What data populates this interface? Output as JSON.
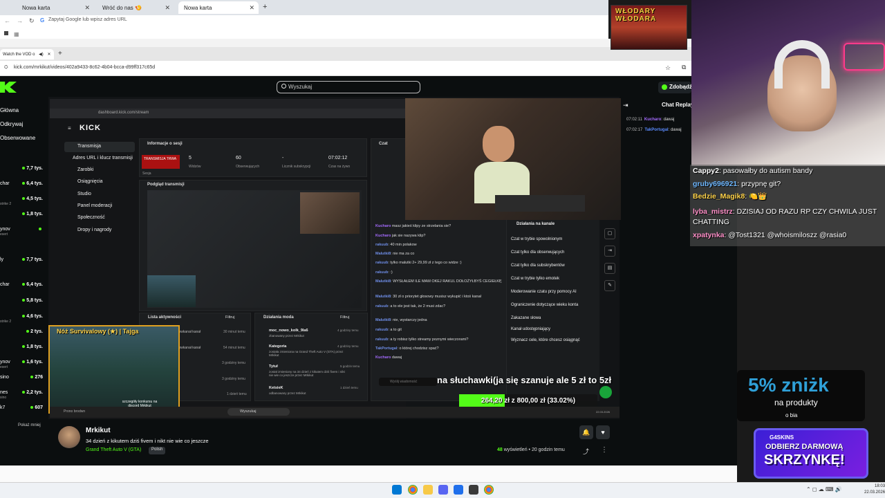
{
  "outer_browser": {
    "tabs": [
      "Nowa karta",
      "Wróć do nas 🍤",
      "Nowa karta"
    ],
    "address_placeholder": "Zapytaj Google lub wpisz adres URL"
  },
  "inner_browser": {
    "tab": "Watch the VOD o",
    "url": "kick.com/mrkikut/videos/402a9433-8c62-4b04-bcca-d99ff317c65d"
  },
  "kick": {
    "search_placeholder": "Wyszukaj",
    "zdobadz": "Zdobądź",
    "chat_replay_title": "Chat Replay",
    "side_nav": [
      "Główna",
      "Odkrywaj",
      "Obserwowane"
    ],
    "channels": [
      {
        "name": "",
        "sub": "",
        "viewers": "7,7 tys."
      },
      {
        "name": "char",
        "sub": "",
        "viewers": "6,4 tys."
      },
      {
        "name": "",
        "sub": "strike 2",
        "viewers": "4,5 tys."
      },
      {
        "name": "",
        "sub": "",
        "viewers": "1,8 tys."
      },
      {
        "name": "ynov",
        "sub": "esert",
        "viewers": ""
      },
      {
        "name": "ly",
        "sub": "",
        "viewers": "7,7 tys."
      },
      {
        "name": "char",
        "sub": "",
        "viewers": "6,4 tys."
      },
      {
        "name": "",
        "sub": "",
        "viewers": "5,8 tys."
      },
      {
        "name": "",
        "sub": "strike 2",
        "viewers": "4,6 tys."
      },
      {
        "name": "",
        "sub": "",
        "viewers": "2 tys."
      },
      {
        "name": "",
        "sub": "",
        "viewers": "1,8 tys."
      },
      {
        "name": "ynov",
        "sub": "esert",
        "viewers": "1,6 tys."
      },
      {
        "name": "sino",
        "sub": "",
        "viewers": "276"
      },
      {
        "name": "nes",
        "sub": "sino",
        "viewers": "2,2 tys."
      },
      {
        "name": "k7",
        "sub": "",
        "viewers": "607"
      }
    ],
    "show_less": "Pokaż mniej",
    "replay_chat": [
      {
        "time": "07:02:11",
        "user": "Kucharo",
        "msg": "dawaj"
      },
      {
        "time": "07:02:17",
        "user": "TakPortugal",
        "msg": "dawaj"
      }
    ]
  },
  "video": {
    "inner_logo": "KICK",
    "inner_url": "dashboard.kick.com/stream",
    "menu": [
      "Transmisja",
      "Adres URL i klucz transmisji",
      "Zarobki",
      "Osiągnięcia",
      "Studio",
      "Panel moderacji",
      "Społeczność",
      "Dropy i nagrody"
    ],
    "session_title": "Informacje o sesji",
    "live_badge": "TRANSMISJA TRWA",
    "stats": [
      {
        "value": "5",
        "label": "Widzów"
      },
      {
        "value": "60",
        "label": "Obserwujących"
      },
      {
        "value": "-",
        "label": "Licznik subskrypcji"
      },
      {
        "value": "07:02:12",
        "label": "Czas na żywo"
      }
    ],
    "session_sub": "Sesja",
    "preview_title": "Podgląd transmisji",
    "chat_title": "Czat",
    "activity_title": "Lista aktywności",
    "filter": "Filtruj",
    "mod_actions_title": "Działania moda",
    "channel_actions_title": "Działania na kanale",
    "channel_actions": [
      "Czat w trybie spowolnionym",
      "Czat tylko dla obserwujących",
      "Czat tylko dla subskrybentów",
      "Czat w trybie tylko emotek",
      "Moderowanie czatu przy pomocy AI",
      "Ograniczenie dotyczące wieku konta",
      "Zakazane słowa",
      "Kanał udostępniający",
      "Wyznacz cele, które chcesz osiągnąć"
    ],
    "inner_chat": [
      {
        "user": "Kucharo",
        "msg": "masz jakieś klipy ze strzelania sie?"
      },
      {
        "user": "Kucharo",
        "msg": "jak sie nazywa klip?"
      },
      {
        "user": "rakuub",
        "msg": "40 min polakow"
      },
      {
        "user": "Malutki8",
        "msg": "nie ma za co"
      },
      {
        "user": "rakuub",
        "msg": "tylko malutki 2+ 29,99 zł z tego co widze :)"
      },
      {
        "user": "rakuub",
        "msg": ":)"
      },
      {
        "user": "Malutki8",
        "msg": "WYSŁAŁEM ILE MAM OKEJ RAKUL DOŁOŻYŁBYŚ CEGIEŁKĘ"
      },
      {
        "user": "Malutki8",
        "msg": "30 zł o priorytet głosowy musisz wykupić i ktoś kanał"
      },
      {
        "user": "rakuub",
        "msg": "a to ele jest tak, że 2 musi zdac?"
      },
      {
        "user": "Malutki8",
        "msg": "nie, wystarczy jedna"
      },
      {
        "user": "rakuub",
        "msg": "a to git"
      },
      {
        "user": "rakuub",
        "msg": "a ty robisz tylko streamy poznymi wieczorami?"
      },
      {
        "user": "TakPortugal",
        "msg": "o której chodzisz spać?"
      },
      {
        "user": "Kucharo",
        "msg": "dawaj"
      }
    ],
    "chat_input_placeholder": "Wyślij wiadomość",
    "activity": [
      {
        "msg": "zowkanał kanał",
        "time": "30 minut temu"
      },
      {
        "msg": "zowkanał kanał",
        "time": "54 minut temu"
      },
      {
        "msg": "",
        "time": "3 godziny temu"
      },
      {
        "msg": "",
        "time": "3 godziny temu"
      },
      {
        "msg": "",
        "time": "1 dzień temu"
      }
    ],
    "mod_actions": [
      {
        "title": "moc_nowo_kolk_9la6",
        "desc": "zbanowany przez Mrkikut",
        "time": "4 godziny temu"
      },
      {
        "title": "Kategoria",
        "desc": "została zmieniona na Grand Theft Auto V (GTA) przez Mrkikut",
        "time": "4 godziny temu"
      },
      {
        "title": "Tytuł",
        "desc": "został zmieniony na 34 dzień z kikutem dziś fivem i nikt nie wie co jeszcze przez Mrkikut",
        "time": "5 godzin temu"
      },
      {
        "title": "KetsieK",
        "desc": "odbanowany przez Mrkikut",
        "time": "1 dzień temu"
      }
    ],
    "caption": "na słuchawki(ja się szanuje ale 5 zł to 5zł",
    "goal_text": "264,20 zł z 800,00 zł (33.02%)",
    "goal_progress": 0.3302,
    "overlay_game_title": "Nóż Survivalowy (★) | Tajga",
    "overlay_game_sub": "szczegóły konkursu na discord Mrkikut",
    "inner_search": "Wyszukaj",
    "inner_taskbar_label": "Prono brodwn",
    "inner_time": "22.03.2026"
  },
  "stream_info": {
    "streamer": "Mrkikut",
    "title": "34 dzień z kikutem dziś fivem i nikt nie wie co jeszcze",
    "category": "Grand Theft Auto V (GTA)",
    "language": "Polish",
    "views_count": "48",
    "views_label": " wyświetleń",
    "ago": "20 godzin temu"
  },
  "overlay": {
    "poster_text": "WŁODARY WŁODARA",
    "chat": [
      {
        "user": "Cappy2",
        "msg": "pasowałby do autism bandy",
        "color": "#ffffff"
      },
      {
        "user": "gruby696921",
        "msg": "przypnę git?",
        "color": "#6fb8ff"
      },
      {
        "user": "Bedzie_Magik8",
        "msg": "🍋👑",
        "color": "#ffd34a"
      },
      {
        "user": "lyba_mistrz",
        "msg": "DZISIAJ OD RAZU RP CZY CHWILA JUST CHATTING",
        "color": "#ff8fc8"
      },
      {
        "user": "xpatynka",
        "msg": "@Tost1321 @whoismiloszz @rasia0",
        "color": "#ff8fc8"
      }
    ],
    "promo_pct": "5% zniżk",
    "promo_sub": "na produkty",
    "promo_sub2": "o bia",
    "promo2_brand": "G4SKINS",
    "promo2_l1": "ODBIERZ DARMOWĄ",
    "promo2_l2": "SKRZYNKĘ!"
  },
  "system": {
    "time": "18:03",
    "date": "22.03.2026"
  }
}
